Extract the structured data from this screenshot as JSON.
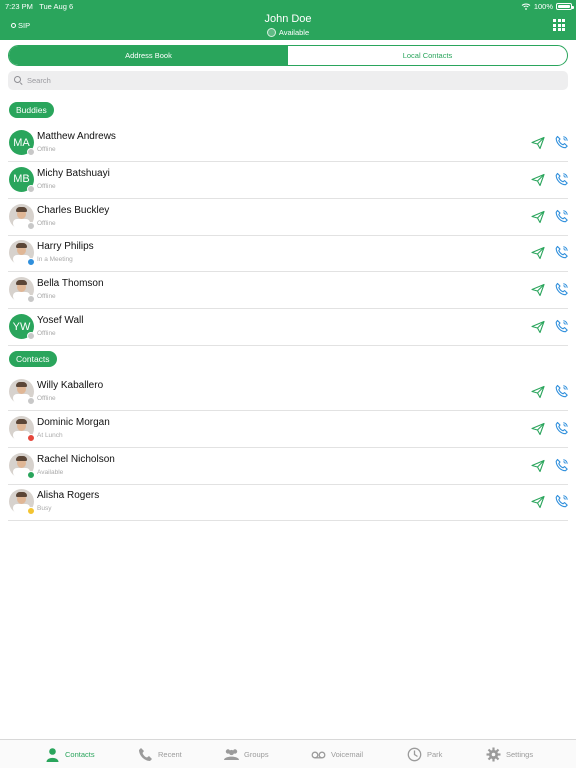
{
  "status_bar": {
    "time": "7:23 PM",
    "date": "Tue Aug 6",
    "battery": "100%"
  },
  "header": {
    "sip_label": "SIP",
    "user_name": "John Doe",
    "user_status": "Available",
    "accent_color": "#2aa55c"
  },
  "segments": {
    "address_book": "Address Book",
    "local_contacts": "Local Contacts",
    "selected": "Address Book"
  },
  "search": {
    "placeholder": "Search"
  },
  "sections": {
    "buddies": "Buddies",
    "contacts": "Contacts"
  },
  "buddies": [
    {
      "initials": "MA",
      "name": "Matthew Andrews",
      "status": "Offline",
      "presence_color": "#c8c8c8"
    },
    {
      "initials": "MB",
      "name": "Michy Batshuayi",
      "status": "Offline",
      "presence_color": "#c8c8c8"
    },
    {
      "name": "Charles Buckley",
      "status": "Offline",
      "presence_color": "#c8c8c8"
    },
    {
      "name": "Harry Philips",
      "status": "In a Meeting",
      "presence_color": "#2f8fdc"
    },
    {
      "name": "Bella Thomson",
      "status": "Offline",
      "presence_color": "#c8c8c8"
    },
    {
      "initials": "YW",
      "name": "Yosef Wall",
      "status": "Offline",
      "presence_color": "#c8c8c8"
    }
  ],
  "contacts": [
    {
      "name": "Willy Kaballero",
      "status": "Offline",
      "presence_color": "#c8c8c8"
    },
    {
      "name": "Dominic Morgan",
      "status": "At Lunch",
      "presence_color": "#e5473c"
    },
    {
      "name": "Rachel Nicholson",
      "status": "Available",
      "presence_color": "#2aa55c"
    },
    {
      "name": "Alisha Rogers",
      "status": "Busy",
      "presence_color": "#f3c431"
    }
  ],
  "tabs": [
    {
      "label": "Contacts",
      "icon": "person-icon"
    },
    {
      "label": "Recent",
      "icon": "phone-icon"
    },
    {
      "label": "Groups",
      "icon": "group-icon"
    },
    {
      "label": "Voicemail",
      "icon": "voicemail-icon"
    },
    {
      "label": "Park",
      "icon": "clock-icon"
    },
    {
      "label": "Settings",
      "icon": "gear-icon"
    }
  ]
}
